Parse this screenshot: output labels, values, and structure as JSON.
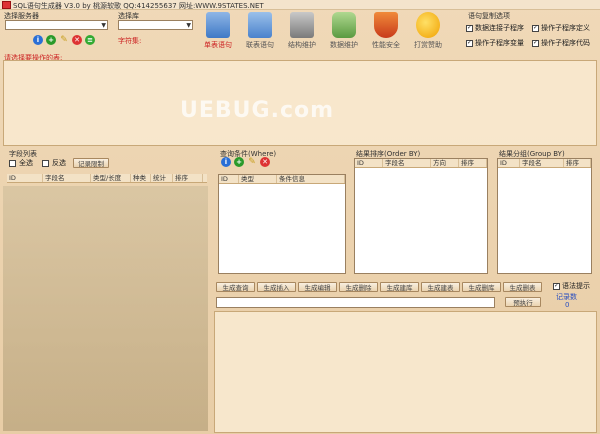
{
  "window": {
    "title": "SQL语句生成器 V3.0 by 桃源软歌  QQ:414255637 网址:WWW.9STATES.NET"
  },
  "server": {
    "label": "选择服务器",
    "value": ""
  },
  "database": {
    "label": "选择库",
    "value": "",
    "charset_label": "字符集:"
  },
  "toolbar": {
    "items": [
      {
        "label": "单表语句",
        "icon": "single-table-icon",
        "color": "#c22"
      },
      {
        "label": "联表语句",
        "icon": "join-table-icon",
        "color": "#555"
      },
      {
        "label": "结构维护",
        "icon": "structure-icon",
        "color": "#555"
      },
      {
        "label": "数据维护",
        "icon": "data-icon",
        "color": "#555"
      },
      {
        "label": "性能安全",
        "icon": "shield-icon",
        "color": "#555"
      },
      {
        "label": "打赏赞助",
        "icon": "sponsor-icon",
        "color": "#555"
      }
    ]
  },
  "options": {
    "title": "语句复制选项",
    "items": [
      {
        "label": "数据连接子程序",
        "checked": true
      },
      {
        "label": "操作子程序定义",
        "checked": true
      },
      {
        "label": "操作子程序变量",
        "checked": true
      },
      {
        "label": "操作子程序代码",
        "checked": true
      }
    ]
  },
  "tip": "请选择要操作的表:",
  "watermark": "UEBUG.com",
  "fields": {
    "title": "字段列表",
    "select_all": "全选",
    "invert": "反选",
    "record_limit": "记录限制",
    "columns": [
      "ID",
      "字段名",
      "类型/长度",
      "种类",
      "统计",
      "排序"
    ]
  },
  "where": {
    "title": "查询条件(Where)",
    "columns": [
      "ID",
      "类型",
      "条件信息"
    ]
  },
  "order": {
    "title": "结果排序(Order BY)",
    "columns": [
      "ID",
      "字段名",
      "方向",
      "排序"
    ]
  },
  "group": {
    "title": "结果分组(Group BY)",
    "columns": [
      "ID",
      "字段名",
      "排序"
    ]
  },
  "actions": {
    "buttons": [
      "生成查询",
      "生成插入",
      "生成编辑",
      "生成删除",
      "生成建库",
      "生成建表",
      "生成删库",
      "生成删表"
    ],
    "pre_exec": "预执行",
    "syntax_hint": "语法提示",
    "record_count_label": "记录数",
    "record_count": "0"
  }
}
